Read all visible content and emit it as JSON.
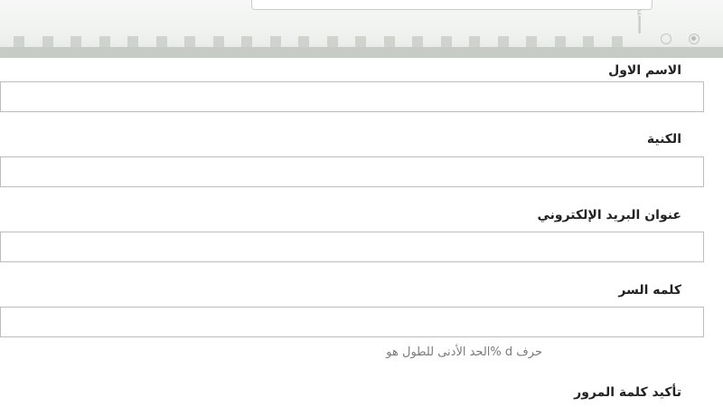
{
  "header": {
    "decorative_glyph": "أ",
    "dash_count": 22
  },
  "form": {
    "first_name": {
      "label": "الاسم الاول",
      "value": ""
    },
    "last_name": {
      "label": "الكنية",
      "value": ""
    },
    "email": {
      "label": "عنوان البريد الإلكتروني",
      "value": ""
    },
    "password": {
      "label": "كلمه السر",
      "value": "",
      "hint": "حرف d %الحد الأدنى للطول هو"
    },
    "confirm_password": {
      "label": "تأكيد كلمة المرور"
    }
  }
}
